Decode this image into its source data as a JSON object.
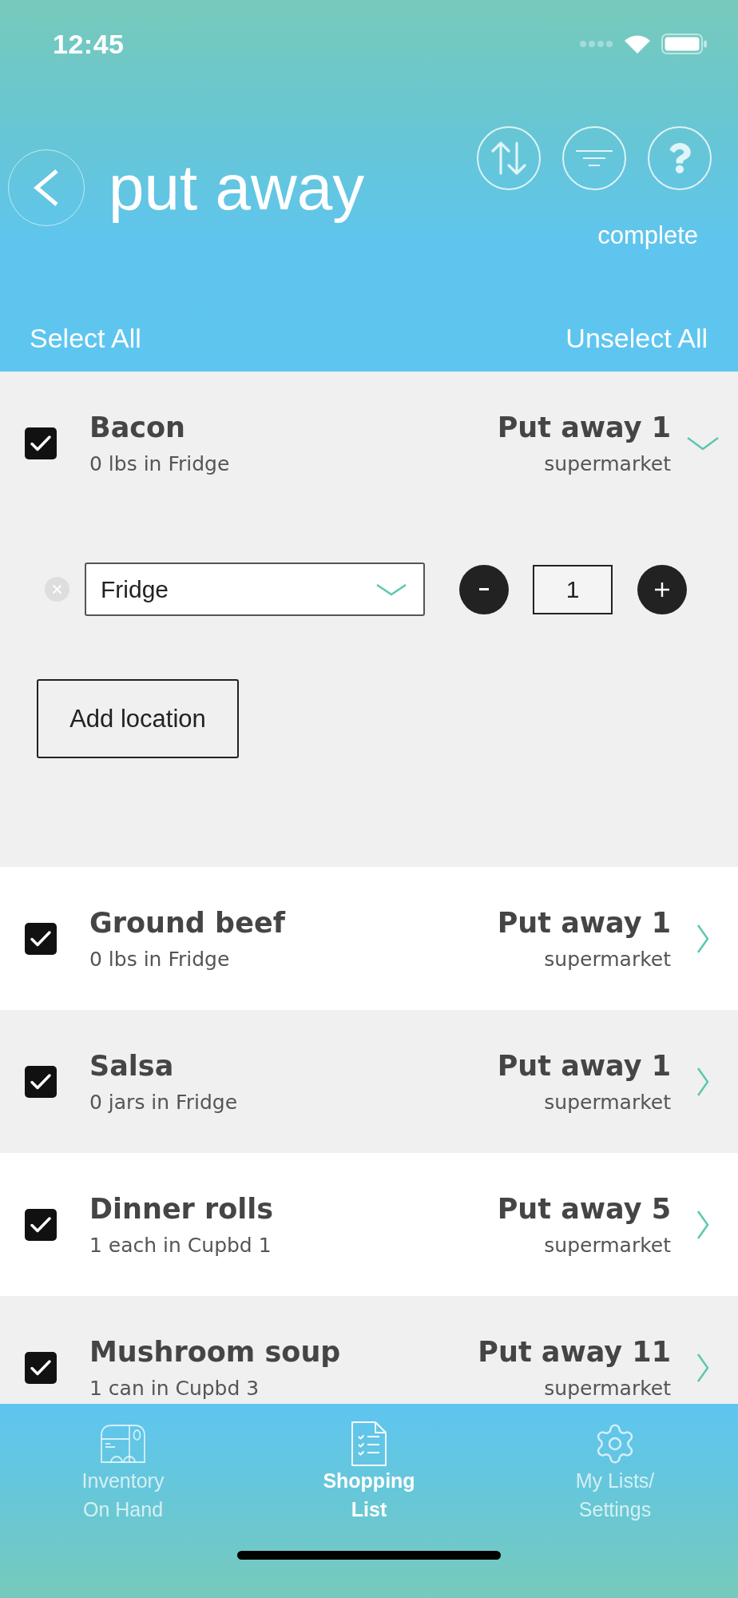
{
  "status_bar": {
    "time": "12:45"
  },
  "header": {
    "title": "put away",
    "status": "complete"
  },
  "selection": {
    "select_all": "Select All",
    "unselect_all": "Unselect All"
  },
  "items": [
    {
      "name": "Bacon",
      "stock": "0 lbs in Fridge",
      "action": "Put away 1",
      "store": "supermarket",
      "checked": true,
      "expanded": true,
      "locations": [
        {
          "place": "Fridge",
          "quantity": "1"
        }
      ],
      "add_location": "Add location"
    },
    {
      "name": "Ground beef",
      "stock": "0 lbs in Fridge",
      "action": "Put away 1",
      "store": "supermarket",
      "checked": true,
      "expanded": false
    },
    {
      "name": "Salsa",
      "stock": "0 jars in Fridge",
      "action": "Put away 1",
      "store": "supermarket",
      "checked": true,
      "expanded": false
    },
    {
      "name": "Dinner rolls",
      "stock": "1 each in Cupbd 1",
      "action": "Put away 5",
      "store": "supermarket",
      "checked": true,
      "expanded": false
    },
    {
      "name": "Mushroom soup",
      "stock": "1 can in Cupbd 3",
      "action": "Put away 11",
      "store": "supermarket",
      "checked": true,
      "expanded": false
    }
  ],
  "tab_bar": [
    {
      "label": "Inventory On Hand",
      "selected": false
    },
    {
      "label": "Shopping List",
      "selected": true
    },
    {
      "label": "My Lists/ Settings",
      "selected": false
    }
  ]
}
